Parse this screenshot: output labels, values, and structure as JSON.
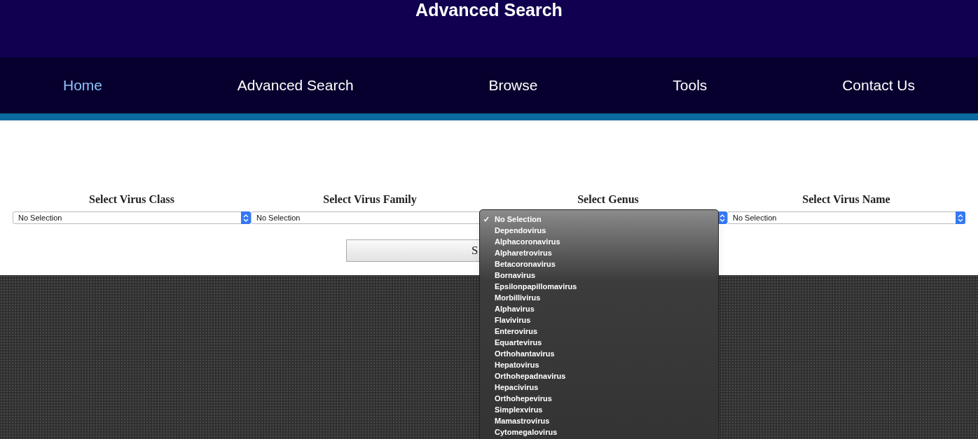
{
  "header": {
    "title": "Advanced Search"
  },
  "nav": [
    {
      "label": "Home",
      "selected": true
    },
    {
      "label": "Advanced Search",
      "selected": false
    },
    {
      "label": "Browse",
      "selected": false
    },
    {
      "label": "Tools",
      "selected": false
    },
    {
      "label": "Contact Us",
      "selected": false
    }
  ],
  "selects": [
    {
      "label": "Select Virus Class",
      "value": "No Selection",
      "open": false
    },
    {
      "label": "Select Virus Family",
      "value": "No Selection",
      "open": false
    },
    {
      "label": "Select Genus",
      "open": true,
      "options": [
        {
          "label": "No Selection",
          "selected": true
        },
        {
          "label": "Dependovirus",
          "selected": false
        },
        {
          "label": "Alphacoronavirus",
          "selected": false
        },
        {
          "label": "Alpharetrovirus",
          "selected": false
        },
        {
          "label": "Betacoronavirus",
          "selected": false
        },
        {
          "label": "Bornavirus",
          "selected": false
        },
        {
          "label": "Epsilonpapillomavirus",
          "selected": false
        },
        {
          "label": "Morbillivirus",
          "selected": false
        },
        {
          "label": "Alphavirus",
          "selected": false
        },
        {
          "label": "Flavivirus",
          "selected": false
        },
        {
          "label": "Enterovirus",
          "selected": false
        },
        {
          "label": "Equartevirus",
          "selected": false
        },
        {
          "label": "Orthohantavirus",
          "selected": false
        },
        {
          "label": "Hepatovirus",
          "selected": false
        },
        {
          "label": "Orthohepadnavirus",
          "selected": false
        },
        {
          "label": "Hepacivirus",
          "selected": false
        },
        {
          "label": "Orthohepevirus",
          "selected": false
        },
        {
          "label": "Simplexvirus",
          "selected": false
        },
        {
          "label": "Mamastrovirus",
          "selected": false
        },
        {
          "label": "Cytomegalovirus",
          "selected": false
        }
      ]
    },
    {
      "label": "Select Virus Name",
      "value": "No Selection",
      "open": false
    }
  ],
  "submit_button": {
    "label": "S"
  }
}
